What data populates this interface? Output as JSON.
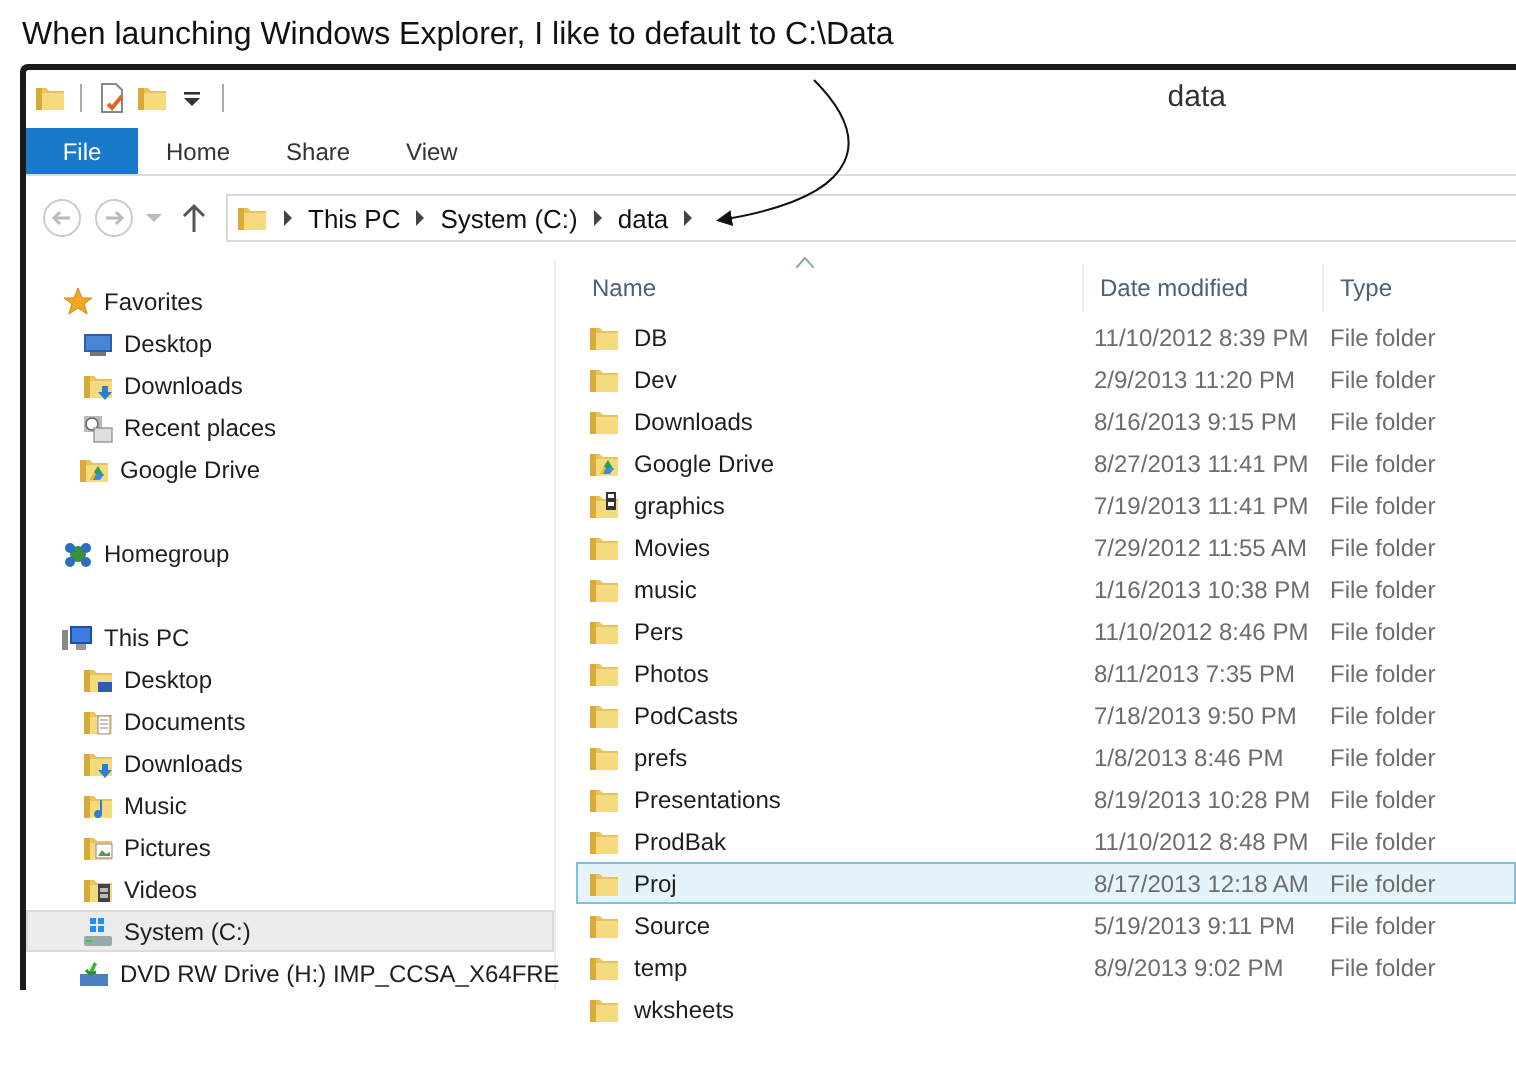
{
  "annotation": "When launching Windows Explorer, I like to default to C:\\Data",
  "window": {
    "title": "data"
  },
  "quick_access": [
    {
      "kind": "folder"
    },
    {
      "kind": "properties"
    },
    {
      "kind": "new-folder"
    },
    {
      "kind": "dropdown"
    }
  ],
  "ribbon_tabs": [
    {
      "label": "File",
      "selected": false,
      "kind": "file"
    },
    {
      "label": "Home",
      "selected": false,
      "kind": "tab"
    },
    {
      "label": "Share",
      "selected": false,
      "kind": "tab"
    },
    {
      "label": "View",
      "selected": false,
      "kind": "tab"
    }
  ],
  "address_bar": {
    "path": [
      "This PC",
      "System (C:)",
      "data"
    ]
  },
  "sidebar": {
    "groups": [
      {
        "label": "Favorites",
        "kind": "star",
        "items": [
          {
            "label": "Desktop",
            "kind": "desktop",
            "selected": false
          },
          {
            "label": "Downloads",
            "kind": "downloads",
            "selected": false
          },
          {
            "label": "Recent places",
            "kind": "recent",
            "selected": false
          },
          {
            "label": "Google Drive",
            "kind": "gdrive",
            "selected": false
          }
        ]
      },
      {
        "label": "Homegroup",
        "kind": "homegroup"
      },
      {
        "label": "This PC",
        "kind": "pc",
        "items": [
          {
            "label": "Desktop",
            "kind": "desktop-folder",
            "selected": false
          },
          {
            "label": "Documents",
            "kind": "documents",
            "selected": false
          },
          {
            "label": "Downloads",
            "kind": "downloads",
            "selected": false
          },
          {
            "label": "Music",
            "kind": "music",
            "selected": false
          },
          {
            "label": "Pictures",
            "kind": "pictures",
            "selected": false
          },
          {
            "label": "Videos",
            "kind": "videos",
            "selected": false
          },
          {
            "label": "System (C:)",
            "kind": "drive",
            "selected": true
          },
          {
            "label": "DVD RW Drive (H:) IMP_CCSA_X64FRE",
            "kind": "dvd",
            "selected": false
          }
        ]
      }
    ]
  },
  "table": {
    "columns": [
      "Name",
      "Date modified",
      "Type"
    ],
    "rows": [
      {
        "name": "DB",
        "date": "11/10/2012 8:39 PM",
        "type": "File folder",
        "kind": "folder",
        "selected": false
      },
      {
        "name": "Dev",
        "date": "2/9/2013 11:20 PM",
        "type": "File folder",
        "kind": "folder",
        "selected": false
      },
      {
        "name": "Downloads",
        "date": "8/16/2013 9:15 PM",
        "type": "File folder",
        "kind": "folder",
        "selected": false
      },
      {
        "name": "Google Drive",
        "date": "8/27/2013 11:41 PM",
        "type": "File folder",
        "kind": "gdrive",
        "selected": false
      },
      {
        "name": "graphics",
        "date": "7/19/2013 11:41 PM",
        "type": "File folder",
        "kind": "graphics",
        "selected": false
      },
      {
        "name": "Movies",
        "date": "7/29/2012 11:55 AM",
        "type": "File folder",
        "kind": "folder",
        "selected": false
      },
      {
        "name": "music",
        "date": "1/16/2013 10:38 PM",
        "type": "File folder",
        "kind": "folder",
        "selected": false
      },
      {
        "name": "Pers",
        "date": "11/10/2012 8:46 PM",
        "type": "File folder",
        "kind": "folder",
        "selected": false
      },
      {
        "name": "Photos",
        "date": "8/11/2013 7:35 PM",
        "type": "File folder",
        "kind": "folder",
        "selected": false
      },
      {
        "name": "PodCasts",
        "date": "7/18/2013 9:50 PM",
        "type": "File folder",
        "kind": "folder",
        "selected": false
      },
      {
        "name": "prefs",
        "date": "1/8/2013 8:46 PM",
        "type": "File folder",
        "kind": "folder",
        "selected": false
      },
      {
        "name": "Presentations",
        "date": "8/19/2013 10:28 PM",
        "type": "File folder",
        "kind": "folder",
        "selected": false
      },
      {
        "name": "ProdBak",
        "date": "11/10/2012 8:48 PM",
        "type": "File folder",
        "kind": "folder",
        "selected": false
      },
      {
        "name": "Proj",
        "date": "8/17/2013 12:18 AM",
        "type": "File folder",
        "kind": "folder",
        "selected": true
      },
      {
        "name": "Source",
        "date": "5/19/2013 9:11 PM",
        "type": "File folder",
        "kind": "folder",
        "selected": false
      },
      {
        "name": "temp",
        "date": "8/9/2013 9:02 PM",
        "type": "File folder",
        "kind": "folder",
        "selected": false
      },
      {
        "name": "wksheets",
        "kind": "folder",
        "selected": false
      }
    ]
  }
}
